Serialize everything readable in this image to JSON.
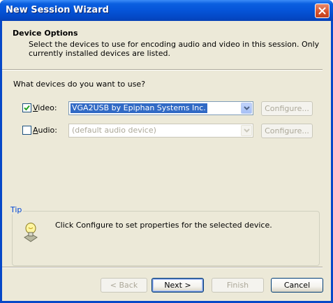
{
  "window": {
    "title": "New Session Wizard"
  },
  "header": {
    "title": "Device Options",
    "description": "Select the devices to use for encoding audio and video in this session. Only currently installed devices are listed."
  },
  "question": "What devices do you want to use?",
  "video": {
    "label_prefix": "",
    "label_accel": "V",
    "label_rest": "ideo:",
    "checked": true,
    "device": "VGA2USB by Epiphan Systems Inc.",
    "configure_label": "Configure..."
  },
  "audio": {
    "label_accel": "A",
    "label_rest": "udio:",
    "checked": false,
    "device": "(default audio device)",
    "configure_label": "Configure..."
  },
  "tip": {
    "legend": "Tip",
    "text": "Click Configure to set properties for the selected device."
  },
  "buttons": {
    "back": "< Back",
    "next": "Next >",
    "finish": "Finish",
    "cancel": "Cancel"
  },
  "colors": {
    "titlebar": "#0554d8",
    "client_bg": "#ece9d8",
    "selection": "#316ac5",
    "tip_legend": "#0046d5"
  },
  "icons": {
    "close": "close-icon",
    "check": "checkmark-icon",
    "dropdown": "chevron-down-icon",
    "tip": "lightbulb-icon"
  }
}
